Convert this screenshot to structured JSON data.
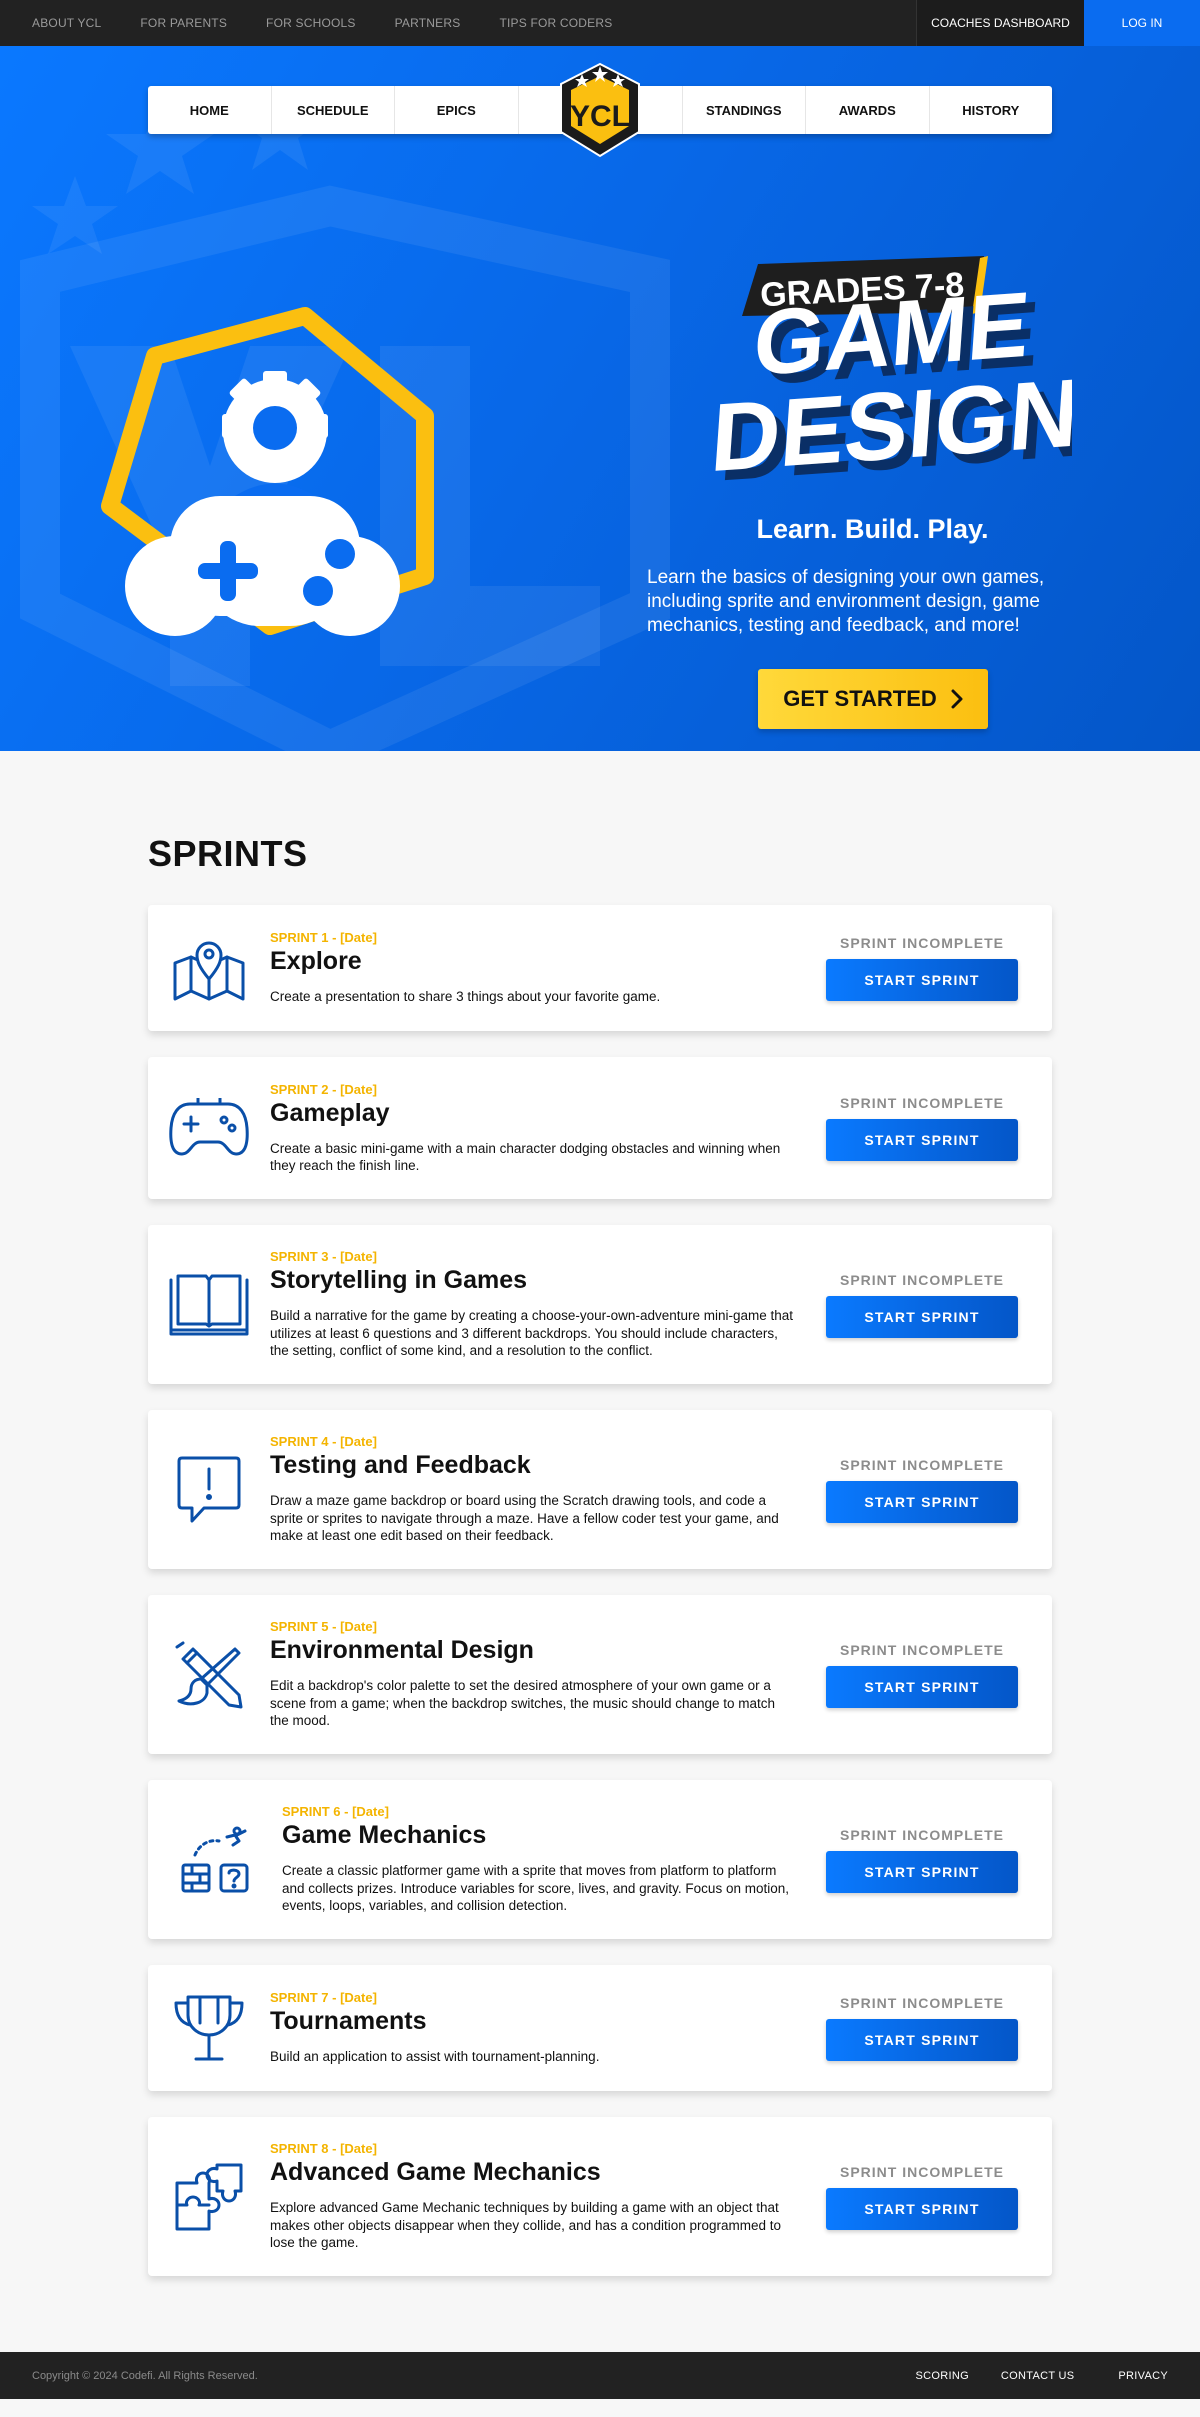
{
  "topbar": {
    "links": [
      "ABOUT YCL",
      "FOR PARENTS",
      "FOR SCHOOLS",
      "PARTNERS",
      "TIPS FOR CODERS"
    ],
    "coaches_label": "COACHES DASHBOARD",
    "login_label": "LOG IN"
  },
  "nav": {
    "left": [
      "HOME",
      "SCHEDULE",
      "EPICS"
    ],
    "right": [
      "STANDINGS",
      "AWARDS",
      "HISTORY"
    ],
    "logo_text": "YCL"
  },
  "hero": {
    "grades": "GRADES 7-8",
    "title_line1": "GAME",
    "title_line2": "DESIGN",
    "tagline": "Learn. Build. Play.",
    "description": "Learn the basics of designing your own games, including sprite and environment design, game mechanics, testing and feedback, and more!",
    "cta_label": "GET STARTED",
    "colors": {
      "blue": "#0a6cf0",
      "yellow": "#fbbf10",
      "dark": "#222222"
    }
  },
  "sprints": {
    "heading": "SPRINTS",
    "status_label": "SPRINT INCOMPLETE",
    "button_label": "START SPRINT",
    "items": [
      {
        "tag": "SPRINT 1 - [Date]",
        "title": "Explore",
        "icon": "map-pin-icon",
        "desc": "Create a presentation to share 3 things about your favorite game."
      },
      {
        "tag": "SPRINT 2 - [Date]",
        "title": "Gameplay",
        "icon": "gamepad-icon",
        "desc": "Create a basic mini-game with a main character dodging obstacles and winning when they reach the finish line."
      },
      {
        "tag": "SPRINT 3 - [Date]",
        "title": "Storytelling in Games",
        "icon": "open-book-icon",
        "desc": "Build a narrative for the game by creating a choose-your-own-adventure mini-game that utilizes at least 6 questions and 3 different backdrops. You should include characters, the setting, conflict of some kind, and a resolution to the conflict."
      },
      {
        "tag": "SPRINT 4 - [Date]",
        "title": "Testing and Feedback",
        "icon": "feedback-bubble-icon",
        "desc": "Draw a maze game backdrop or board using the Scratch drawing tools, and code a sprite or sprites to navigate through a maze. Have a fellow coder test your game, and make at least one edit based on their feedback."
      },
      {
        "tag": "SPRINT 5 - [Date]",
        "title": "Environmental Design",
        "icon": "pencil-brush-icon",
        "desc": "Edit a backdrop's color palette to set the desired atmosphere of your own game or a scene from a game; when the backdrop switches, the music should change to match the mood."
      },
      {
        "tag": "SPRINT 6 - [Date]",
        "title": "Game Mechanics",
        "icon": "platformer-icon",
        "desc": "Create a classic platformer game with a sprite that moves from platform to platform and collects prizes. Introduce variables for score, lives, and gravity. Focus on motion, events, loops, variables, and collision detection."
      },
      {
        "tag": "SPRINT 7 - [Date]",
        "title": "Tournaments",
        "icon": "trophy-icon",
        "desc": "Build an application to assist with tournament-planning."
      },
      {
        "tag": "SPRINT 8 - [Date]",
        "title": "Advanced Game Mechanics",
        "icon": "puzzle-icon",
        "desc": "Explore advanced Game Mechanic techniques by building a game with an object that makes other objects disappear when they collide, and has a condition programmed to lose the game."
      }
    ]
  },
  "footer": {
    "copyright": "Copyright © 2024 Codefi. All Rights Reserved.",
    "links": [
      "SCORING",
      "CONTACT US",
      "PRIVACY"
    ]
  }
}
